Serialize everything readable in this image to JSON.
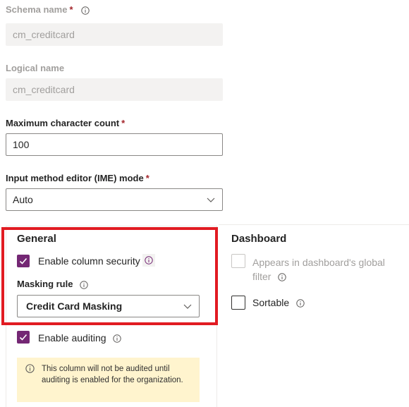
{
  "schema_name": {
    "label": "Schema name",
    "value": "cm_creditcard"
  },
  "logical_name": {
    "label": "Logical name",
    "value": "cm_creditcard"
  },
  "max_char_count": {
    "label": "Maximum character count",
    "value": "100"
  },
  "ime_mode": {
    "label": "Input method editor (IME) mode",
    "value": "Auto"
  },
  "required_mark": "*",
  "general": {
    "title": "General",
    "column_security_label": "Enable column security",
    "masking_rule_label": "Masking rule",
    "masking_rule_value": "Credit Card Masking",
    "auditing_label": "Enable auditing",
    "auditing_notice": "This column will not be audited until auditing is enabled for the organization."
  },
  "dashboard": {
    "title": "Dashboard",
    "global_filter_label_line1": "Appears in dashboard's global",
    "global_filter_label_line2": "filter",
    "sortable_label": "Sortable"
  },
  "colors": {
    "accent": "#742774",
    "highlight": "#e11b22",
    "notice_bg": "#fff4ce",
    "required": "#a4262c"
  }
}
